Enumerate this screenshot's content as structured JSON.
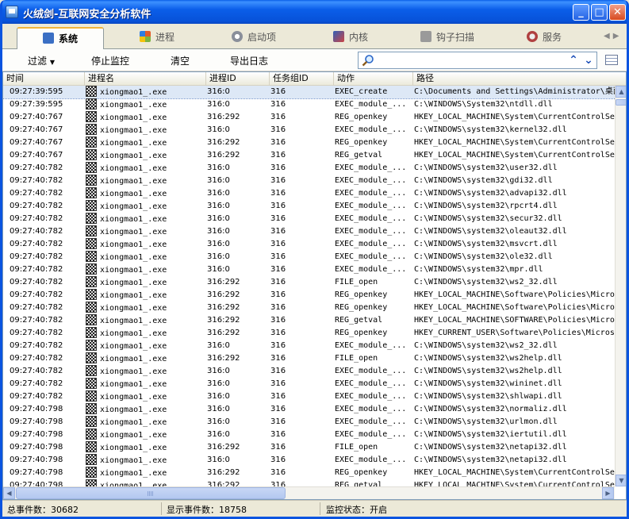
{
  "window": {
    "title": "火绒剑-互联网安全分析软件",
    "min_label": "_",
    "max_label": "□",
    "close_label": "✕"
  },
  "tabs": [
    {
      "label": "系统",
      "icon": "monitor-icon",
      "icon_color": "#3b6fc4",
      "active": true
    },
    {
      "label": "进程",
      "icon": "windows-icon",
      "icon_color": "#e35b28",
      "active": false
    },
    {
      "label": "启动项",
      "icon": "gear-icon",
      "icon_color": "#8a8f9a",
      "active": false
    },
    {
      "label": "内核",
      "icon": "kernel-icon",
      "icon_color": "#3160b8",
      "active": false
    },
    {
      "label": "钩子扫描",
      "icon": "hook-icon",
      "icon_color": "#7a7a7a",
      "active": false
    },
    {
      "label": "服务",
      "icon": "service-icon",
      "icon_color": "#b04040",
      "active": false
    }
  ],
  "toolbar": {
    "filter_label": "过滤",
    "stop_label": "停止监控",
    "clear_label": "清空",
    "export_label": "导出日志",
    "search_value": ""
  },
  "columns": [
    "时间",
    "进程名",
    "进程ID",
    "任务组ID",
    "动作",
    "路径"
  ],
  "rows": [
    {
      "time": "09:27:39:595",
      "proc": "xiongmao1_.exe",
      "pid": "316:0",
      "job": "316",
      "act": "EXEC_create",
      "path": "C:\\Documents and Settings\\Administrator\\桌面\\",
      "selected": true
    },
    {
      "time": "09:27:39:595",
      "proc": "xiongmao1_.exe",
      "pid": "316:0",
      "job": "316",
      "act": "EXEC_module_...",
      "path": "C:\\WINDOWS\\System32\\ntdll.dll"
    },
    {
      "time": "09:27:40:767",
      "proc": "xiongmao1_.exe",
      "pid": "316:292",
      "job": "316",
      "act": "REG_openkey",
      "path": "HKEY_LOCAL_MACHINE\\System\\CurrentControlSet"
    },
    {
      "time": "09:27:40:767",
      "proc": "xiongmao1_.exe",
      "pid": "316:0",
      "job": "316",
      "act": "EXEC_module_...",
      "path": "C:\\WINDOWS\\system32\\kernel32.dll"
    },
    {
      "time": "09:27:40:767",
      "proc": "xiongmao1_.exe",
      "pid": "316:292",
      "job": "316",
      "act": "REG_openkey",
      "path": "HKEY_LOCAL_MACHINE\\System\\CurrentControlSet"
    },
    {
      "time": "09:27:40:767",
      "proc": "xiongmao1_.exe",
      "pid": "316:292",
      "job": "316",
      "act": "REG_getval",
      "path": "HKEY_LOCAL_MACHINE\\System\\CurrentControlSet"
    },
    {
      "time": "09:27:40:782",
      "proc": "xiongmao1_.exe",
      "pid": "316:0",
      "job": "316",
      "act": "EXEC_module_...",
      "path": "C:\\WINDOWS\\system32\\user32.dll"
    },
    {
      "time": "09:27:40:782",
      "proc": "xiongmao1_.exe",
      "pid": "316:0",
      "job": "316",
      "act": "EXEC_module_...",
      "path": "C:\\WINDOWS\\system32\\gdi32.dll"
    },
    {
      "time": "09:27:40:782",
      "proc": "xiongmao1_.exe",
      "pid": "316:0",
      "job": "316",
      "act": "EXEC_module_...",
      "path": "C:\\WINDOWS\\system32\\advapi32.dll"
    },
    {
      "time": "09:27:40:782",
      "proc": "xiongmao1_.exe",
      "pid": "316:0",
      "job": "316",
      "act": "EXEC_module_...",
      "path": "C:\\WINDOWS\\system32\\rpcrt4.dll"
    },
    {
      "time": "09:27:40:782",
      "proc": "xiongmao1_.exe",
      "pid": "316:0",
      "job": "316",
      "act": "EXEC_module_...",
      "path": "C:\\WINDOWS\\system32\\secur32.dll"
    },
    {
      "time": "09:27:40:782",
      "proc": "xiongmao1_.exe",
      "pid": "316:0",
      "job": "316",
      "act": "EXEC_module_...",
      "path": "C:\\WINDOWS\\system32\\oleaut32.dll"
    },
    {
      "time": "09:27:40:782",
      "proc": "xiongmao1_.exe",
      "pid": "316:0",
      "job": "316",
      "act": "EXEC_module_...",
      "path": "C:\\WINDOWS\\system32\\msvcrt.dll"
    },
    {
      "time": "09:27:40:782",
      "proc": "xiongmao1_.exe",
      "pid": "316:0",
      "job": "316",
      "act": "EXEC_module_...",
      "path": "C:\\WINDOWS\\system32\\ole32.dll"
    },
    {
      "time": "09:27:40:782",
      "proc": "xiongmao1_.exe",
      "pid": "316:0",
      "job": "316",
      "act": "EXEC_module_...",
      "path": "C:\\WINDOWS\\system32\\mpr.dll"
    },
    {
      "time": "09:27:40:782",
      "proc": "xiongmao1_.exe",
      "pid": "316:292",
      "job": "316",
      "act": "FILE_open",
      "path": "C:\\WINDOWS\\system32\\ws2_32.dll"
    },
    {
      "time": "09:27:40:782",
      "proc": "xiongmao1_.exe",
      "pid": "316:292",
      "job": "316",
      "act": "REG_openkey",
      "path": "HKEY_LOCAL_MACHINE\\Software\\Policies\\Micros"
    },
    {
      "time": "09:27:40:782",
      "proc": "xiongmao1_.exe",
      "pid": "316:292",
      "job": "316",
      "act": "REG_openkey",
      "path": "HKEY_LOCAL_MACHINE\\Software\\Policies\\Micros"
    },
    {
      "time": "09:27:40:782",
      "proc": "xiongmao1_.exe",
      "pid": "316:292",
      "job": "316",
      "act": "REG_getval",
      "path": "HKEY_LOCAL_MACHINE\\SOFTWARE\\Policies\\Micros"
    },
    {
      "time": "09:27:40:782",
      "proc": "xiongmao1_.exe",
      "pid": "316:292",
      "job": "316",
      "act": "REG_openkey",
      "path": "HKEY_CURRENT_USER\\Software\\Policies\\Microso"
    },
    {
      "time": "09:27:40:782",
      "proc": "xiongmao1_.exe",
      "pid": "316:0",
      "job": "316",
      "act": "EXEC_module_...",
      "path": "C:\\WINDOWS\\system32\\ws2_32.dll"
    },
    {
      "time": "09:27:40:782",
      "proc": "xiongmao1_.exe",
      "pid": "316:292",
      "job": "316",
      "act": "FILE_open",
      "path": "C:\\WINDOWS\\system32\\ws2help.dll"
    },
    {
      "time": "09:27:40:782",
      "proc": "xiongmao1_.exe",
      "pid": "316:0",
      "job": "316",
      "act": "EXEC_module_...",
      "path": "C:\\WINDOWS\\system32\\ws2help.dll"
    },
    {
      "time": "09:27:40:782",
      "proc": "xiongmao1_.exe",
      "pid": "316:0",
      "job": "316",
      "act": "EXEC_module_...",
      "path": "C:\\WINDOWS\\system32\\wininet.dll"
    },
    {
      "time": "09:27:40:782",
      "proc": "xiongmao1_.exe",
      "pid": "316:0",
      "job": "316",
      "act": "EXEC_module_...",
      "path": "C:\\WINDOWS\\system32\\shlwapi.dll"
    },
    {
      "time": "09:27:40:798",
      "proc": "xiongmao1_.exe",
      "pid": "316:0",
      "job": "316",
      "act": "EXEC_module_...",
      "path": "C:\\WINDOWS\\system32\\normaliz.dll"
    },
    {
      "time": "09:27:40:798",
      "proc": "xiongmao1_.exe",
      "pid": "316:0",
      "job": "316",
      "act": "EXEC_module_...",
      "path": "C:\\WINDOWS\\system32\\urlmon.dll"
    },
    {
      "time": "09:27:40:798",
      "proc": "xiongmao1_.exe",
      "pid": "316:0",
      "job": "316",
      "act": "EXEC_module_...",
      "path": "C:\\WINDOWS\\system32\\iertutil.dll"
    },
    {
      "time": "09:27:40:798",
      "proc": "xiongmao1_.exe",
      "pid": "316:292",
      "job": "316",
      "act": "FILE_open",
      "path": "C:\\WINDOWS\\system32\\netapi32.dll"
    },
    {
      "time": "09:27:40:798",
      "proc": "xiongmao1_.exe",
      "pid": "316:0",
      "job": "316",
      "act": "EXEC_module_...",
      "path": "C:\\WINDOWS\\system32\\netapi32.dll"
    },
    {
      "time": "09:27:40:798",
      "proc": "xiongmao1_.exe",
      "pid": "316:292",
      "job": "316",
      "act": "REG_openkey",
      "path": "HKEY_LOCAL_MACHINE\\System\\CurrentControlSet"
    },
    {
      "time": "09:27:40:798",
      "proc": "xiongmao1_.exe",
      "pid": "316:292",
      "job": "316",
      "act": "REG_getval",
      "path": "HKEY_LOCAL_MACHINE\\System\\CurrentControlSet"
    }
  ],
  "status": {
    "total": "总事件数：30682",
    "shown": "显示事件数：18758",
    "monitor": "监控状态：开启"
  }
}
